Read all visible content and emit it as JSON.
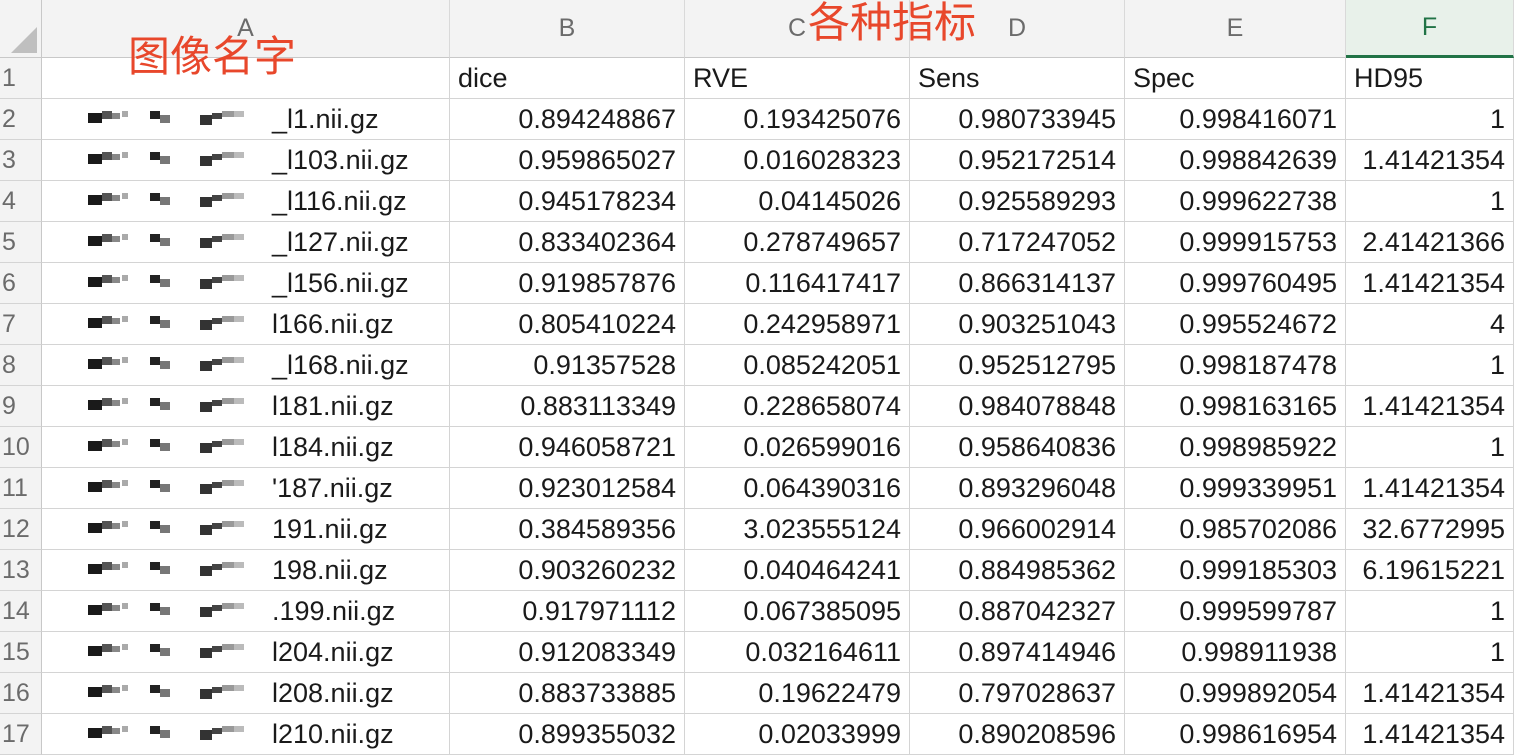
{
  "columns": [
    "A",
    "B",
    "C",
    "D",
    "E",
    "F"
  ],
  "header_row": {
    "num": "1",
    "A": "",
    "B": "dice",
    "C": "RVE",
    "D": "Sens",
    "E": "Spec",
    "F": "HD95"
  },
  "rows": [
    {
      "num": "2",
      "name": "_l1.nii.gz",
      "dice": "0.894248867",
      "rve": "0.193425076",
      "sens": "0.980733945",
      "spec": "0.998416071",
      "hd95": "1"
    },
    {
      "num": "3",
      "name": "_l103.nii.gz",
      "dice": "0.959865027",
      "rve": "0.016028323",
      "sens": "0.952172514",
      "spec": "0.998842639",
      "hd95": "1.41421354"
    },
    {
      "num": "4",
      "name": "_l116.nii.gz",
      "dice": "0.945178234",
      "rve": "0.04145026",
      "sens": "0.925589293",
      "spec": "0.999622738",
      "hd95": "1"
    },
    {
      "num": "5",
      "name": "_l127.nii.gz",
      "dice": "0.833402364",
      "rve": "0.278749657",
      "sens": "0.717247052",
      "spec": "0.999915753",
      "hd95": "2.41421366"
    },
    {
      "num": "6",
      "name": "_l156.nii.gz",
      "dice": "0.919857876",
      "rve": "0.116417417",
      "sens": "0.866314137",
      "spec": "0.999760495",
      "hd95": "1.41421354"
    },
    {
      "num": "7",
      "name": "l166.nii.gz",
      "dice": "0.805410224",
      "rve": "0.242958971",
      "sens": "0.903251043",
      "spec": "0.995524672",
      "hd95": "4"
    },
    {
      "num": "8",
      "name": "_l168.nii.gz",
      "dice": "0.91357528",
      "rve": "0.085242051",
      "sens": "0.952512795",
      "spec": "0.998187478",
      "hd95": "1"
    },
    {
      "num": "9",
      "name": "l181.nii.gz",
      "dice": "0.883113349",
      "rve": "0.228658074",
      "sens": "0.984078848",
      "spec": "0.998163165",
      "hd95": "1.41421354"
    },
    {
      "num": "10",
      "name": "l184.nii.gz",
      "dice": "0.946058721",
      "rve": "0.026599016",
      "sens": "0.958640836",
      "spec": "0.998985922",
      "hd95": "1"
    },
    {
      "num": "11",
      "name": "'187.nii.gz",
      "dice": "0.923012584",
      "rve": "0.064390316",
      "sens": "0.893296048",
      "spec": "0.999339951",
      "hd95": "1.41421354"
    },
    {
      "num": "12",
      "name": "191.nii.gz",
      "dice": "0.384589356",
      "rve": "3.023555124",
      "sens": "0.966002914",
      "spec": "0.985702086",
      "hd95": "32.6772995"
    },
    {
      "num": "13",
      "name": "198.nii.gz",
      "dice": "0.903260232",
      "rve": "0.040464241",
      "sens": "0.884985362",
      "spec": "0.999185303",
      "hd95": "6.19615221"
    },
    {
      "num": "14",
      "name": ".199.nii.gz",
      "dice": "0.917971112",
      "rve": "0.067385095",
      "sens": "0.887042327",
      "spec": "0.999599787",
      "hd95": "1"
    },
    {
      "num": "15",
      "name": "l204.nii.gz",
      "dice": "0.912083349",
      "rve": "0.032164611",
      "sens": "0.897414946",
      "spec": "0.998911938",
      "hd95": "1"
    },
    {
      "num": "16",
      "name": "l208.nii.gz",
      "dice": "0.883733885",
      "rve": "0.19622479",
      "sens": "0.797028637",
      "spec": "0.999892054",
      "hd95": "1.41421354"
    },
    {
      "num": "17",
      "name": "l210.nii.gz",
      "dice": "0.899355032",
      "rve": "0.02033999",
      "sens": "0.890208596",
      "spec": "0.998616954",
      "hd95": "1.41421354"
    }
  ],
  "annotations": {
    "image_names": "图像名字",
    "metrics": "各种指标"
  },
  "colors": {
    "annotation": "#e8472b",
    "active_column": "#217346",
    "header_bg": "#f3f3f3",
    "grid": "#d4d4d4"
  }
}
